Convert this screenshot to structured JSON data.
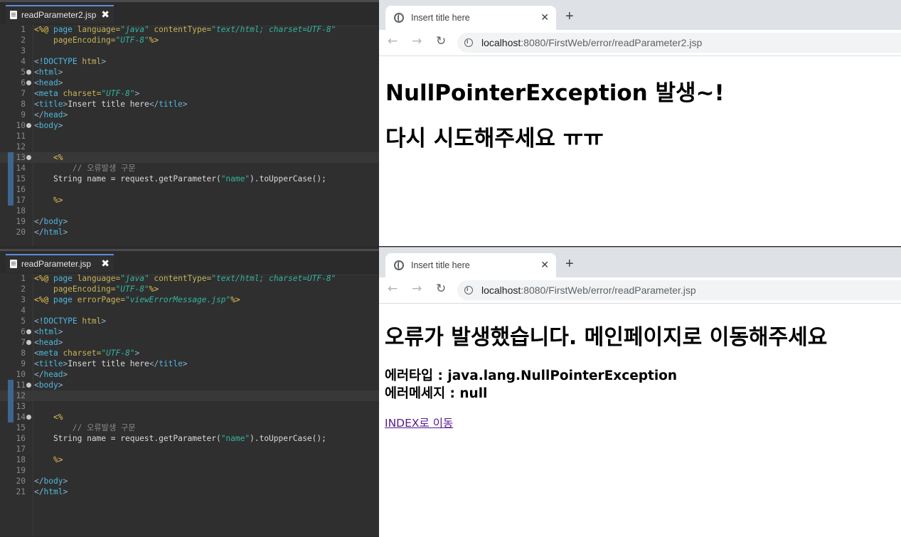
{
  "editor_top": {
    "tab_label": "readParameter2.jsp",
    "lines": [
      {
        "num": "1",
        "fold": false,
        "hl": false,
        "mark": false,
        "segs": [
          [
            "jsp",
            "<%@ "
          ],
          [
            "tag",
            "page "
          ],
          [
            "attr",
            "language="
          ],
          [
            "str",
            "\"java\" "
          ],
          [
            "attr",
            "contentType="
          ],
          [
            "str",
            "\"text/html; charset=UTF-8\""
          ]
        ]
      },
      {
        "num": "2",
        "fold": false,
        "hl": false,
        "mark": false,
        "segs": [
          [
            "kw",
            "    "
          ],
          [
            "attr",
            "pageEncoding="
          ],
          [
            "str",
            "\"UTF-8\""
          ],
          [
            "jsp",
            "%>"
          ]
        ]
      },
      {
        "num": "3",
        "fold": false,
        "hl": false,
        "mark": false,
        "segs": []
      },
      {
        "num": "4",
        "fold": false,
        "hl": false,
        "mark": false,
        "segs": [
          [
            "pun",
            "<!"
          ],
          [
            "tag",
            "DOCTYPE "
          ],
          [
            "attr",
            "html"
          ],
          [
            "pun",
            ">"
          ]
        ]
      },
      {
        "num": "5",
        "fold": true,
        "hl": false,
        "mark": false,
        "segs": [
          [
            "pun",
            "<"
          ],
          [
            "tag",
            "html"
          ],
          [
            "pun",
            ">"
          ]
        ]
      },
      {
        "num": "6",
        "fold": true,
        "hl": false,
        "mark": false,
        "segs": [
          [
            "pun",
            "<"
          ],
          [
            "tag",
            "head"
          ],
          [
            "pun",
            ">"
          ]
        ]
      },
      {
        "num": "7",
        "fold": false,
        "hl": false,
        "mark": false,
        "segs": [
          [
            "pun",
            "<"
          ],
          [
            "tag",
            "meta "
          ],
          [
            "attr",
            "charset="
          ],
          [
            "str",
            "\"UTF-8\""
          ],
          [
            "pun",
            ">"
          ]
        ]
      },
      {
        "num": "8",
        "fold": false,
        "hl": false,
        "mark": false,
        "segs": [
          [
            "pun",
            "<"
          ],
          [
            "tag",
            "title"
          ],
          [
            "pun",
            ">"
          ],
          [
            "kw",
            "Insert title here"
          ],
          [
            "pun",
            "</"
          ],
          [
            "tag",
            "title"
          ],
          [
            "pun",
            ">"
          ]
        ]
      },
      {
        "num": "9",
        "fold": false,
        "hl": false,
        "mark": false,
        "segs": [
          [
            "pun",
            "</"
          ],
          [
            "tag",
            "head"
          ],
          [
            "pun",
            ">"
          ]
        ]
      },
      {
        "num": "10",
        "fold": true,
        "hl": false,
        "mark": false,
        "segs": [
          [
            "pun",
            "<"
          ],
          [
            "tag",
            "body"
          ],
          [
            "pun",
            ">"
          ]
        ]
      },
      {
        "num": "11",
        "fold": false,
        "hl": false,
        "mark": false,
        "segs": []
      },
      {
        "num": "12",
        "fold": false,
        "hl": false,
        "mark": false,
        "segs": []
      },
      {
        "num": "13",
        "fold": true,
        "hl": true,
        "mark": true,
        "segs": [
          [
            "kw",
            "    "
          ],
          [
            "jsp",
            "<%"
          ]
        ]
      },
      {
        "num": "14",
        "fold": false,
        "hl": false,
        "mark": true,
        "segs": [
          [
            "kw",
            "        "
          ],
          [
            "cmt",
            "// 오류발생 구문"
          ]
        ]
      },
      {
        "num": "15",
        "fold": false,
        "hl": false,
        "mark": true,
        "segs": [
          [
            "kw",
            "    String name = request.getParameter("
          ],
          [
            "s2",
            "\"name\""
          ],
          [
            "kw",
            ").toUpperCase();"
          ]
        ]
      },
      {
        "num": "16",
        "fold": false,
        "hl": false,
        "mark": true,
        "segs": []
      },
      {
        "num": "17",
        "fold": false,
        "hl": false,
        "mark": true,
        "segs": [
          [
            "kw",
            "    "
          ],
          [
            "jsp",
            "%>"
          ]
        ]
      },
      {
        "num": "18",
        "fold": false,
        "hl": false,
        "mark": false,
        "segs": []
      },
      {
        "num": "19",
        "fold": false,
        "hl": false,
        "mark": false,
        "segs": [
          [
            "pun",
            "</"
          ],
          [
            "tag",
            "body"
          ],
          [
            "pun",
            ">"
          ]
        ]
      },
      {
        "num": "20",
        "fold": false,
        "hl": false,
        "mark": false,
        "segs": [
          [
            "pun",
            "</"
          ],
          [
            "tag",
            "html"
          ],
          [
            "pun",
            ">"
          ]
        ]
      }
    ]
  },
  "editor_bottom": {
    "tab_label": "readParameter.jsp",
    "lines": [
      {
        "num": "1",
        "fold": false,
        "hl": false,
        "mark": false,
        "segs": [
          [
            "jsp",
            "<%@ "
          ],
          [
            "tag",
            "page "
          ],
          [
            "attr",
            "language="
          ],
          [
            "str",
            "\"java\" "
          ],
          [
            "attr",
            "contentType="
          ],
          [
            "str",
            "\"text/html; charset=UTF-8\""
          ]
        ]
      },
      {
        "num": "2",
        "fold": false,
        "hl": false,
        "mark": false,
        "segs": [
          [
            "kw",
            "    "
          ],
          [
            "attr",
            "pageEncoding="
          ],
          [
            "str",
            "\"UTF-8\""
          ],
          [
            "jsp",
            "%>"
          ]
        ]
      },
      {
        "num": "3",
        "fold": false,
        "hl": false,
        "mark": false,
        "segs": [
          [
            "jsp",
            "<%@ "
          ],
          [
            "tag",
            "page "
          ],
          [
            "attr",
            "errorPage="
          ],
          [
            "str",
            "\"viewErrorMessage.jsp\""
          ],
          [
            "jsp",
            "%>"
          ]
        ]
      },
      {
        "num": "4",
        "fold": false,
        "hl": false,
        "mark": false,
        "segs": []
      },
      {
        "num": "5",
        "fold": false,
        "hl": false,
        "mark": false,
        "segs": [
          [
            "pun",
            "<!"
          ],
          [
            "tag",
            "DOCTYPE "
          ],
          [
            "attr",
            "html"
          ],
          [
            "pun",
            ">"
          ]
        ]
      },
      {
        "num": "6",
        "fold": true,
        "hl": false,
        "mark": false,
        "segs": [
          [
            "pun",
            "<"
          ],
          [
            "tag",
            "html"
          ],
          [
            "pun",
            ">"
          ]
        ]
      },
      {
        "num": "7",
        "fold": true,
        "hl": false,
        "mark": false,
        "segs": [
          [
            "pun",
            "<"
          ],
          [
            "tag",
            "head"
          ],
          [
            "pun",
            ">"
          ]
        ]
      },
      {
        "num": "8",
        "fold": false,
        "hl": false,
        "mark": false,
        "segs": [
          [
            "pun",
            "<"
          ],
          [
            "tag",
            "meta "
          ],
          [
            "attr",
            "charset="
          ],
          [
            "str",
            "\"UTF-8\""
          ],
          [
            "pun",
            ">"
          ]
        ]
      },
      {
        "num": "9",
        "fold": false,
        "hl": false,
        "mark": false,
        "segs": [
          [
            "pun",
            "<"
          ],
          [
            "tag",
            "title"
          ],
          [
            "pun",
            ">"
          ],
          [
            "kw",
            "Insert title here"
          ],
          [
            "pun",
            "</"
          ],
          [
            "tag",
            "title"
          ],
          [
            "pun",
            ">"
          ]
        ]
      },
      {
        "num": "10",
        "fold": false,
        "hl": false,
        "mark": false,
        "segs": [
          [
            "pun",
            "</"
          ],
          [
            "tag",
            "head"
          ],
          [
            "pun",
            ">"
          ]
        ]
      },
      {
        "num": "11",
        "fold": true,
        "hl": false,
        "mark": true,
        "segs": [
          [
            "pun",
            "<"
          ],
          [
            "tag",
            "body"
          ],
          [
            "pun",
            ">"
          ]
        ]
      },
      {
        "num": "12",
        "fold": false,
        "hl": true,
        "mark": true,
        "segs": []
      },
      {
        "num": "13",
        "fold": false,
        "hl": false,
        "mark": true,
        "segs": []
      },
      {
        "num": "14",
        "fold": true,
        "hl": false,
        "mark": true,
        "segs": [
          [
            "kw",
            "    "
          ],
          [
            "jsp",
            "<%"
          ]
        ]
      },
      {
        "num": "15",
        "fold": false,
        "hl": false,
        "mark": false,
        "segs": [
          [
            "kw",
            "        "
          ],
          [
            "cmt",
            "// 오류발생 구문"
          ]
        ]
      },
      {
        "num": "16",
        "fold": false,
        "hl": false,
        "mark": false,
        "segs": [
          [
            "kw",
            "    String name = request.getParameter("
          ],
          [
            "s2",
            "\"name\""
          ],
          [
            "kw",
            ").toUpperCase();"
          ]
        ]
      },
      {
        "num": "17",
        "fold": false,
        "hl": false,
        "mark": false,
        "segs": []
      },
      {
        "num": "18",
        "fold": false,
        "hl": false,
        "mark": false,
        "segs": [
          [
            "kw",
            "    "
          ],
          [
            "jsp",
            "%>"
          ]
        ]
      },
      {
        "num": "19",
        "fold": false,
        "hl": false,
        "mark": false,
        "segs": []
      },
      {
        "num": "20",
        "fold": false,
        "hl": false,
        "mark": false,
        "segs": [
          [
            "pun",
            "</"
          ],
          [
            "tag",
            "body"
          ],
          [
            "pun",
            ">"
          ]
        ]
      },
      {
        "num": "21",
        "fold": false,
        "hl": false,
        "mark": false,
        "segs": [
          [
            "pun",
            "</"
          ],
          [
            "tag",
            "html"
          ],
          [
            "pun",
            ">"
          ]
        ]
      }
    ]
  },
  "browser_top": {
    "tab_title": "Insert title here",
    "tab_close": "✕",
    "new_tab": "+",
    "url_host": "localhost",
    "url_path": ":8080/FirstWeb/error/readParameter2.jsp",
    "heading1": "NullPointerException 발생~!",
    "heading2": "다시 시도해주세요 ㅠㅠ"
  },
  "browser_bottom": {
    "tab_title": "Insert title here",
    "tab_close": "✕",
    "new_tab": "+",
    "url_host": "localhost",
    "url_path": ":8080/FirstWeb/error/readParameter.jsp",
    "heading1": "오류가 발생했습니다. 메인페이지로 이동해주세요",
    "error_type": "에러타입 : java.lang.NullPointerException",
    "error_message": "에러메세지 : null",
    "link": "INDEX로 이동"
  },
  "icons": {
    "back": "←",
    "forward": "→",
    "reload": "↻",
    "editor_close": "✖"
  },
  "colors": {
    "editor_bg": "#2f2f2f",
    "tab_accent": "#5b8dd9",
    "visited_link": "#551a8b"
  }
}
